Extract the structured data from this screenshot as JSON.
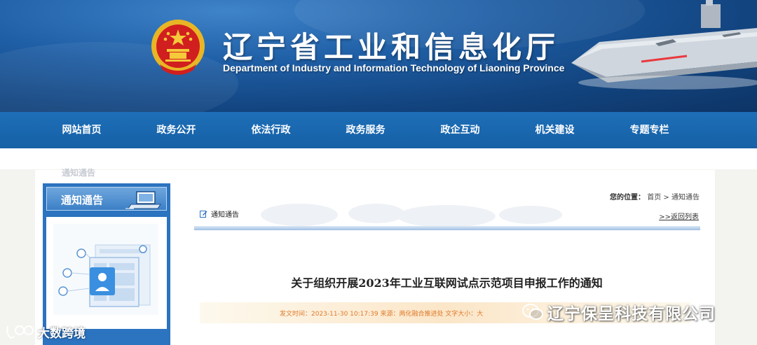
{
  "header": {
    "title": "辽宁省工业和信息化厅",
    "subtitle": "Department of Industry and Information Technology of Liaoning Province",
    "brand_color": "#1660a6"
  },
  "nav": {
    "items": [
      {
        "label": "网站首页"
      },
      {
        "label": "政务公开"
      },
      {
        "label": "依法行政"
      },
      {
        "label": "政务服务"
      },
      {
        "label": "政企互动"
      },
      {
        "label": "机关建设"
      },
      {
        "label": "专题专栏"
      }
    ]
  },
  "ghost_heading": "通知通告",
  "sidebar": {
    "title": "通知通告",
    "icons": [
      "laptop-icon",
      "web-illustration"
    ]
  },
  "main": {
    "breadcrumb": {
      "prefix": "您的位置：",
      "home": "首页",
      "separator": ">",
      "current": "通知通告"
    },
    "section_label": "通知通告",
    "back_link": ">>返回列表",
    "article_title": "关于组织开展2023年工业互联网试点示范项目申报工作的通知",
    "meta": "发文时间：2023-11-30 10:17:39 来源：两化融合推进处 文字大小：大"
  },
  "watermarks": {
    "right": "辽宁保呈科技有限公司",
    "left": "大数跨境"
  }
}
